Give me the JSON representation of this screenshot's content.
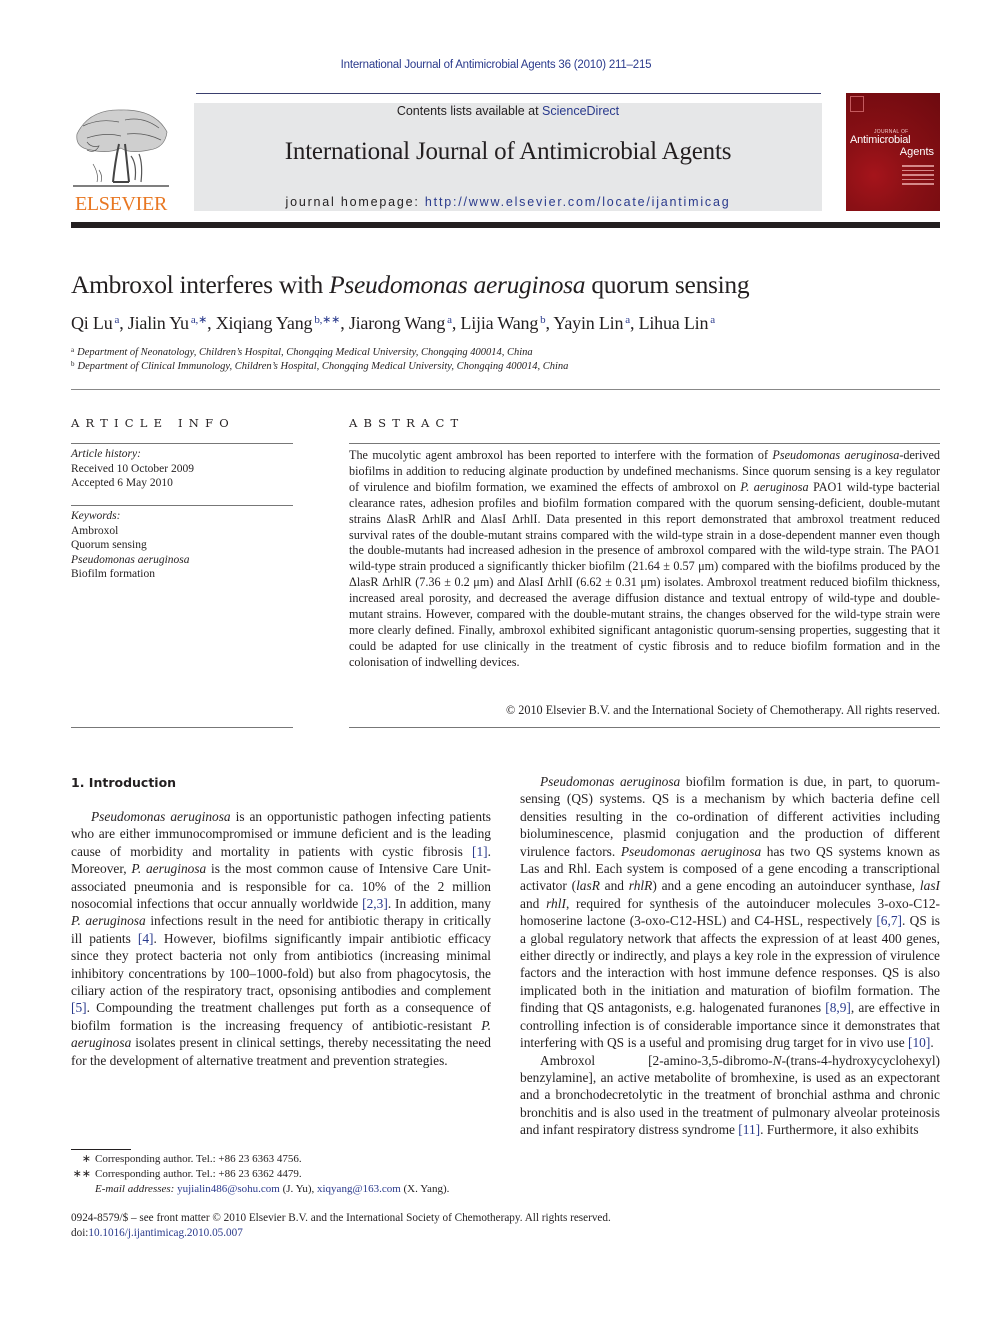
{
  "citation": "International Journal of Antimicrobial Agents 36 (2010) 211–215",
  "header": {
    "publisher_wordmark": "ELSEVIER",
    "contents_prefix": "Contents lists available at ",
    "contents_link": "ScienceDirect",
    "journal_title": "International Journal of Antimicrobial Agents",
    "homepage_prefix": "journal homepage: ",
    "homepage_url": "http://www.elsevier.com/locate/ijantimicag",
    "cover": {
      "small_line": "JOURNAL OF",
      "title_line1": "Antimicrobial",
      "title_line2": "Agents"
    }
  },
  "colors": {
    "link": "#2a3a8c",
    "elsevier_orange": "#e87722",
    "header_band": "#e6e7e8",
    "cover_red": "#8a1015"
  },
  "article": {
    "title_part1": "Ambroxol interferes with ",
    "title_italic": "Pseudomonas aeruginosa",
    "title_part2": " quorum sensing",
    "authors": [
      {
        "name": "Qi Lu",
        "aff": "a"
      },
      {
        "name": "Jialin Yu",
        "aff": "a,∗"
      },
      {
        "name": "Xiqiang Yang",
        "aff": "b,∗∗"
      },
      {
        "name": "Jiarong Wang",
        "aff": "a"
      },
      {
        "name": "Lijia Wang",
        "aff": "b"
      },
      {
        "name": "Yayin Lin",
        "aff": "a"
      },
      {
        "name": "Lihua Lin",
        "aff": "a"
      }
    ],
    "affiliations": [
      {
        "mark": "a",
        "text": "Department of Neonatology, Children’s Hospital, Chongqing Medical University, Chongqing 400014, China"
      },
      {
        "mark": "b",
        "text": "Department of Clinical Immunology, Children’s Hospital, Chongqing Medical University, Chongqing 400014, China"
      }
    ]
  },
  "article_info": {
    "heading": "ARTICLE INFO",
    "history_label": "Article history:",
    "received": "Received 10 October 2009",
    "accepted": "Accepted 6 May 2010",
    "keywords_label": "Keywords:",
    "keywords": [
      "Ambroxol",
      "Quorum sensing",
      "Pseudomonas aeruginosa",
      "Biofilm formation"
    ]
  },
  "abstract": {
    "heading": "ABSTRACT",
    "segments": [
      {
        "t": "The mucolytic agent ambroxol has been reported to interfere with the formation of "
      },
      {
        "t": "Pseudomonas aeruginosa",
        "i": true
      },
      {
        "t": "-derived biofilms in addition to reducing alginate production by undefined mechanisms. Since quorum sensing is a key regulator of virulence and biofilm formation, we examined the effects of ambroxol on "
      },
      {
        "t": "P. aeruginosa",
        "i": true
      },
      {
        "t": " PAO1 wild-type bacterial clearance rates, adhesion profiles and biofilm formation compared with the quorum sensing-deficient, double-mutant strains ΔlasR ΔrhlR and ΔlasI ΔrhlI. Data presented in this report demonstrated that ambroxol treatment reduced survival rates of the double-mutant strains compared with the wild-type strain in a dose-dependent manner even though the double-mutants had increased adhesion in the presence of ambroxol compared with the wild-type strain. The PAO1 wild-type strain produced a significantly thicker biofilm (21.64 ± 0.57 μm) compared with the biofilms produced by the ΔlasR ΔrhlR (7.36 ± 0.2 μm) and ΔlasI ΔrhlI (6.62 ± 0.31 μm) isolates. Ambroxol treatment reduced biofilm thickness, increased areal porosity, and decreased the average diffusion distance and textual entropy of wild-type and double-mutant strains. However, compared with the double-mutant strains, the changes observed for the wild-type strain were more clearly defined. Finally, ambroxol exhibited significant antagonistic quorum-sensing properties, suggesting that it could be adapted for use clinically in the treatment of cystic fibrosis and to reduce biofilm formation and in the colonisation of indwelling devices."
      }
    ],
    "copyright": "© 2010 Elsevier B.V. and the International Society of Chemotherapy. All rights reserved."
  },
  "intro": {
    "heading": "1.  Introduction",
    "left_paragraphs": [
      [
        {
          "t": "Pseudomonas aeruginosa",
          "i": true
        },
        {
          "t": " is an opportunistic pathogen infecting patients who are either immunocompromised or immune deficient and is the leading cause of morbidity and mortality in patients with cystic fibrosis "
        },
        {
          "t": "[1]",
          "ref": true
        },
        {
          "t": ". Moreover, "
        },
        {
          "t": "P. aeruginosa",
          "i": true
        },
        {
          "t": " is the most common cause of Intensive Care Unit-associated pneumonia and is responsible for ca. 10% of the 2 million nosocomial infections that occur annually worldwide "
        },
        {
          "t": "[2,3]",
          "ref": true
        },
        {
          "t": ". In addition, many "
        },
        {
          "t": "P. aeruginosa",
          "i": true
        },
        {
          "t": " infections result in the need for antibiotic therapy in critically ill patients "
        },
        {
          "t": "[4]",
          "ref": true
        },
        {
          "t": ". However, biofilms significantly impair antibiotic efficacy since they protect bacteria not only from antibiotics (increasing minimal inhibitory concentrations by 100–1000-fold) but also from phagocytosis, the ciliary action of the respiratory tract, opsonising antibodies and complement "
        },
        {
          "t": "[5]",
          "ref": true
        },
        {
          "t": ". Compounding the treatment challenges put forth as a consequence of biofilm formation is the increasing frequency of antibiotic-resistant "
        },
        {
          "t": "P. aeruginosa",
          "i": true
        },
        {
          "t": " isolates present in clinical settings, thereby necessitating the need for the development of alternative treatment and prevention strategies."
        }
      ]
    ],
    "right_paragraphs": [
      [
        {
          "t": "Pseudomonas aeruginosa",
          "i": true
        },
        {
          "t": " biofilm formation is due, in part, to quorum-sensing (QS) systems. QS is a mechanism by which bacteria define cell densities resulting in the co-ordination of different activities including bioluminescence, plasmid conjugation and the production of different virulence factors. "
        },
        {
          "t": "Pseudomonas aeruginosa",
          "i": true
        },
        {
          "t": " has two QS systems known as Las and Rhl. Each system is composed of a gene encoding a transcriptional activator ("
        },
        {
          "t": "lasR",
          "i": true
        },
        {
          "t": " and "
        },
        {
          "t": "rhlR",
          "i": true
        },
        {
          "t": ") and a gene encoding an autoinducer synthase, "
        },
        {
          "t": "lasI",
          "i": true
        },
        {
          "t": " and "
        },
        {
          "t": "rhlI",
          "i": true
        },
        {
          "t": ", required for synthesis of the autoinducer molecules 3-oxo-C12-homoserine lactone (3-oxo-C12-HSL) and C4-HSL, respectively "
        },
        {
          "t": "[6,7]",
          "ref": true
        },
        {
          "t": ". QS is a global regulatory network that affects the expression of at least 400 genes, either directly or indirectly, and plays a key role in the expression of virulence factors and the interaction with host immune defence responses. QS is also implicated both in the initiation and maturation of biofilm formation. The finding that QS antagonists, e.g. halogenated furanones "
        },
        {
          "t": "[8,9]",
          "ref": true
        },
        {
          "t": ", are effective in controlling infection is of considerable importance since it demonstrates that interfering with QS is a useful and promising drug target for in vivo use "
        },
        {
          "t": "[10]",
          "ref": true
        },
        {
          "t": "."
        }
      ],
      [
        {
          "t": "Ambroxol [2-amino-3,5-dibromo-"
        },
        {
          "t": "N",
          "i": true
        },
        {
          "t": "-(trans-4-hydroxycyclohexyl) benzylamine], an active metabolite of bromhexine, is used as an expectorant and a bronchodecretolytic in the treatment of bronchial asthma and chronic bronchitis and is also used in the treatment of pulmonary alveolar proteinosis and infant respiratory distress syndrome "
        },
        {
          "t": "[11]",
          "ref": true
        },
        {
          "t": ". Furthermore, it also exhibits"
        }
      ]
    ]
  },
  "footnotes": {
    "fn1_mark": "∗",
    "fn1_text": "Corresponding author. Tel.: +86 23 6363 4756.",
    "fn2_mark": "∗∗",
    "fn2_text": "Corresponding author. Tel.: +86 23 6362 4479.",
    "email_label": "E-mail addresses:",
    "email1": "yujialin486@sohu.com",
    "email1_owner": " (J. Yu), ",
    "email2": "xiqyang@163.com",
    "email2_owner": " (X. Yang)."
  },
  "bottom": {
    "issn_line": "0924-8579/$ – see front matter © 2010 Elsevier B.V. and the International Society of Chemotherapy. All rights reserved.",
    "doi_prefix": "doi:",
    "doi": "10.1016/j.ijantimicag.2010.05.007"
  }
}
